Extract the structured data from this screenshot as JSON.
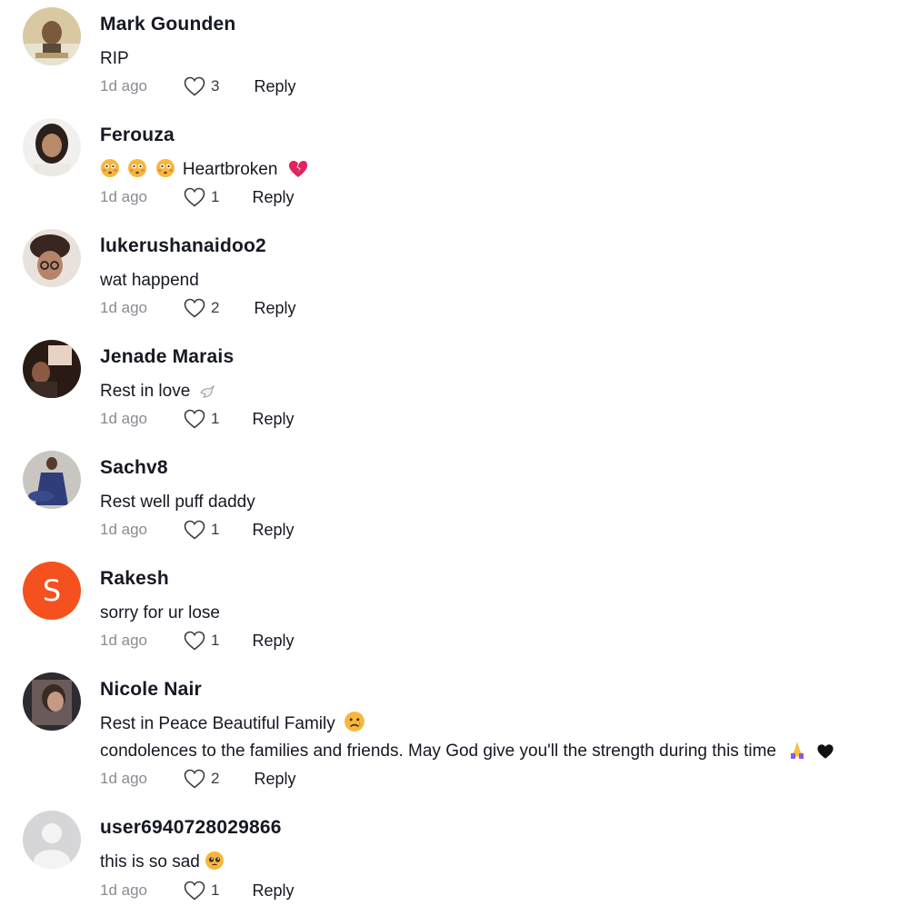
{
  "comments": [
    {
      "username": "Mark Gounden",
      "lines": [
        "RIP"
      ],
      "time": "1d ago",
      "likes": "3",
      "reply": "Reply",
      "avatar": "mark-avatar-photo"
    },
    {
      "username": "Ferouza",
      "lines": [
        "Heartbroken"
      ],
      "time": "1d ago",
      "likes": "1",
      "reply": "Reply",
      "avatar": "ferouza-avatar-photo"
    },
    {
      "username": "lukerushanaidoo2",
      "lines": [
        "wat happend"
      ],
      "time": "1d ago",
      "likes": "2",
      "reply": "Reply",
      "avatar": "luke-avatar-photo"
    },
    {
      "username": "Jenade Marais",
      "lines": [
        "Rest in love"
      ],
      "time": "1d ago",
      "likes": "1",
      "reply": "Reply",
      "avatar": "jenade-avatar-photo"
    },
    {
      "username": "Sachv8",
      "lines": [
        "Rest well puff daddy"
      ],
      "time": "1d ago",
      "likes": "1",
      "reply": "Reply",
      "avatar": "sachv8-avatar-photo"
    },
    {
      "username": "Rakesh",
      "lines": [
        "sorry for ur lose"
      ],
      "time": "1d ago",
      "likes": "1",
      "reply": "Reply",
      "avatar_letter": "S",
      "avatar_color": "#f4511e"
    },
    {
      "username": "Nicole Nair",
      "lines": [
        "Rest in Peace Beautiful Family",
        "condolences to the families and friends. May God give you'll the strength during this time"
      ],
      "time": "1d ago",
      "likes": "2",
      "reply": "Reply",
      "avatar": "nicole-avatar-photo"
    },
    {
      "username": "user6940728029866",
      "lines": [
        "this is so sad"
      ],
      "time": "1d ago",
      "likes": "1",
      "reply": "Reply",
      "avatar": "default-user-avatar"
    }
  ],
  "colors": {
    "text": "#161823",
    "muted": "#8a8b91",
    "letter_avatar": "#f4511e"
  },
  "icons": [
    "heart-outline-icon",
    "flushed-face-emoji",
    "broken-heart-emoji",
    "dove-emoji",
    "sad-face-emoji",
    "praying-hands-emoji",
    "black-heart-emoji",
    "pleading-face-emoji"
  ]
}
